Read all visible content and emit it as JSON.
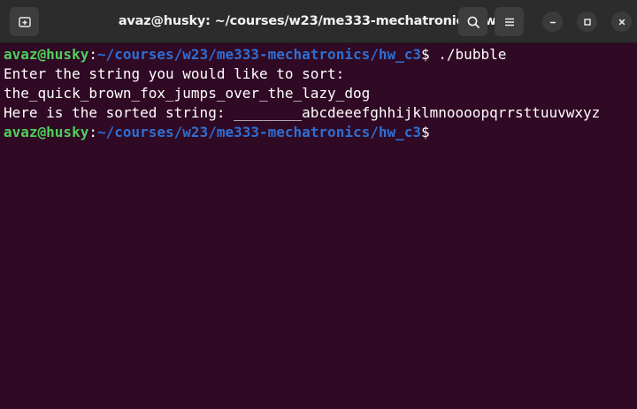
{
  "window": {
    "title": "avaz@husky: ~/courses/w23/me333-mechatronics/hw_c3"
  },
  "icons": {
    "new_tab": "new-tab-icon",
    "search": "search-icon",
    "menu": "hamburger-menu-icon",
    "minimize": "minimize-icon",
    "maximize": "maximize-icon",
    "close": "close-icon"
  },
  "colors": {
    "terminal_bg": "#300a24",
    "user_host": "#4ecf5b",
    "path": "#2f6ed2",
    "text": "#ffffff"
  },
  "terminal": {
    "prompt1": {
      "user_host": "avaz@husky",
      "sep": ":",
      "path": "~/courses/w23/me333-mechatronics/hw_c3",
      "dollar": "$ ",
      "command": "./bubble"
    },
    "output": [
      "Enter the string you would like to sort:",
      "the_quick_brown_fox_jumps_over_the_lazy_dog",
      "Here is the sorted string: ________abcdeeefghhijklmnoooopqrrsttuuvwxyz"
    ],
    "prompt2": {
      "user_host": "avaz@husky",
      "sep": ":",
      "path": "~/courses/w23/me333-mechatronics/hw_c3",
      "dollar": "$"
    }
  }
}
